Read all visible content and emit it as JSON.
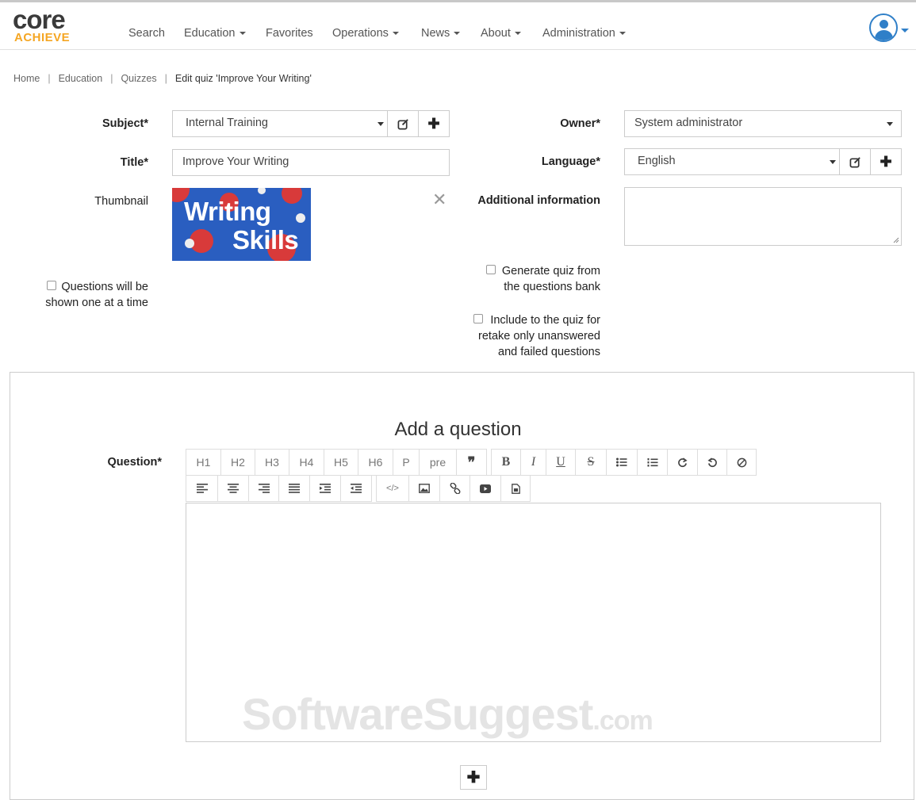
{
  "app": {
    "logo_text": "core",
    "logo_sub": "ACHIEVE",
    "brand_color": "#f5a623",
    "accent_color": "#2f7fc8"
  },
  "nav": {
    "items": [
      {
        "label": "Search",
        "dropdown": false
      },
      {
        "label": "Education",
        "dropdown": true
      },
      {
        "label": "Favorites",
        "dropdown": false
      },
      {
        "label": "Operations",
        "dropdown": true
      },
      {
        "label": "News",
        "dropdown": true
      },
      {
        "label": "About",
        "dropdown": true
      },
      {
        "label": "Administration",
        "dropdown": true
      }
    ],
    "user_icon": "user-avatar-icon"
  },
  "breadcrumb": {
    "items": [
      "Home",
      "Education",
      "Quizzes"
    ],
    "current": "Edit quiz 'Improve Your Writing'"
  },
  "form": {
    "subject": {
      "label": "Subject*",
      "value": "Internal Training"
    },
    "title": {
      "label": "Title*",
      "value": "Improve Your Writing"
    },
    "thumbnail": {
      "label": "Thumbnail",
      "line1": "Writing",
      "line2": "Skills",
      "remove_icon": "close-icon"
    },
    "questions_one_at_time": {
      "line1": "Questions will be",
      "line2": "shown one at a time",
      "checked": false
    },
    "owner": {
      "label": "Owner*",
      "value": "System administrator"
    },
    "language": {
      "label": "Language*",
      "value": "English"
    },
    "additional_info": {
      "label": "Additional information",
      "value": ""
    },
    "generate_from_bank": {
      "line1": "Generate quiz from",
      "line2": "the questions bank",
      "checked": false
    },
    "include_retake": {
      "line1": "Include to the quiz for",
      "line2": "retake only unanswered",
      "line3": "and failed questions",
      "checked": false
    },
    "edit_icon": "edit-icon",
    "add_icon": "plus-icon"
  },
  "question_panel": {
    "title": "Add a question",
    "question_label": "Question*",
    "toolbar_row1": [
      "H1",
      "H2",
      "H3",
      "H4",
      "H5",
      "H6",
      "P",
      "pre"
    ],
    "toolbar_icons_row1": [
      "quote-icon",
      "bold-icon",
      "italic-icon",
      "underline-icon",
      "strikethrough-icon",
      "bullet-list-icon",
      "numbered-list-icon",
      "redo-icon",
      "undo-icon",
      "clear-format-icon"
    ],
    "toolbar_icons_row2": [
      "align-left-icon",
      "align-center-icon",
      "align-right-icon",
      "justify-icon",
      "indent-icon",
      "outdent-icon",
      "code-icon",
      "image-icon",
      "link-icon",
      "video-icon",
      "file-icon"
    ],
    "editor_value": "",
    "add_button_icon": "plus-icon"
  },
  "watermark": {
    "text": "SoftwareSuggest",
    "suffix": ".com"
  }
}
